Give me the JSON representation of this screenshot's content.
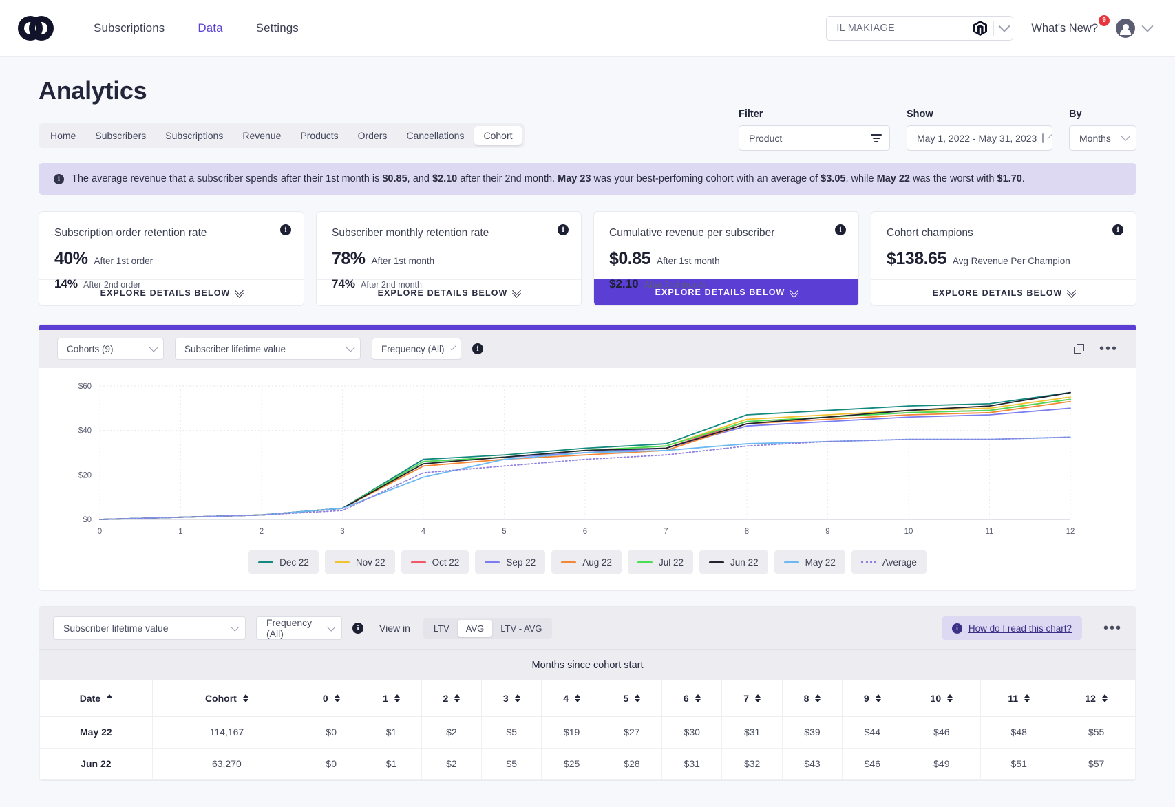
{
  "header": {
    "logo_icon": "loop-logo-icon",
    "nav": [
      {
        "label": "Subscriptions",
        "active": false
      },
      {
        "label": "Data",
        "active": true
      },
      {
        "label": "Settings",
        "active": false
      }
    ],
    "store_selector": {
      "value": "IL MAKIAGE",
      "icon": "magento-icon"
    },
    "whats_new": {
      "label": "What's New?",
      "badge": "9"
    },
    "avatar_icon": "user-avatar-icon"
  },
  "page_title": "Analytics",
  "tabs": [
    {
      "label": "Home",
      "active": false
    },
    {
      "label": "Subscribers",
      "active": false
    },
    {
      "label": "Subscriptions",
      "active": false
    },
    {
      "label": "Revenue",
      "active": false
    },
    {
      "label": "Products",
      "active": false
    },
    {
      "label": "Orders",
      "active": false
    },
    {
      "label": "Cancellations",
      "active": false
    },
    {
      "label": "Cohort",
      "active": true
    }
  ],
  "filters": {
    "filter_label": "Filter",
    "filter_value": "Product",
    "show_label": "Show",
    "show_value": "May 1, 2022  -  May 31, 2023",
    "by_label": "By",
    "by_value": "Months"
  },
  "banner": {
    "part1": "The average revenue that a subscriber spends after their 1st month is ",
    "b1": "$0.85",
    "part2": ", and ",
    "b2": "$2.10",
    "part3": " after their 2nd month. ",
    "b3": "May 23",
    "part4": " was your best-perfoming cohort with an average of ",
    "b4": "$3.05",
    "part5": ", while ",
    "b5": "May 22",
    "part6": " was the worst with ",
    "b6": "$1.70",
    "part7": "."
  },
  "kpis": [
    {
      "title": "Subscription order retention rate",
      "big": "40%",
      "big_sub": "After 1st order",
      "med": "14%",
      "med_sub": "After 2nd order",
      "cta": "EXPLORE DETAILS BELOW",
      "primary": false
    },
    {
      "title": "Subscriber monthly retention rate",
      "big": "78%",
      "big_sub": "After 1st month",
      "med": "74%",
      "med_sub": "After 2nd month",
      "cta": "EXPLORE DETAILS BELOW",
      "primary": false
    },
    {
      "title": "Cumulative revenue per subscriber",
      "big": "$0.85",
      "big_sub": "After 1st month",
      "med": "$2.10",
      "med_sub": "After 2nd month",
      "cta": "EXPLORE DETAILS BELOW",
      "primary": true
    },
    {
      "title": "Cohort champions",
      "big": "$138.65",
      "big_sub": "Avg Revenue Per Champion",
      "med": "",
      "med_sub": "",
      "cta": "EXPLORE DETAILS BELOW",
      "primary": false
    }
  ],
  "chart_controls": {
    "cohorts": "Cohorts (9)",
    "metric": "Subscriber lifetime value",
    "frequency": "Frequency (All)"
  },
  "chart_data": {
    "type": "line",
    "title": "",
    "xlabel": "",
    "ylabel": "",
    "x": [
      0,
      1,
      2,
      3,
      4,
      5,
      6,
      7,
      8,
      9,
      10,
      11,
      12
    ],
    "xticks": [
      "0",
      "1",
      "2",
      "3",
      "4",
      "5",
      "6",
      "7",
      "8",
      "9",
      "10",
      "11",
      "12"
    ],
    "yticks": [
      "$0",
      "$20",
      "$40",
      "$60"
    ],
    "ylim": [
      0,
      60
    ],
    "grid": true,
    "legend_position": "bottom",
    "series": [
      {
        "name": "Dec 22",
        "color": "#14897f",
        "style": "solid",
        "values": [
          0,
          1,
          2,
          5,
          27,
          29,
          32,
          34,
          47,
          49,
          51,
          52,
          57
        ]
      },
      {
        "name": "Nov 22",
        "color": "#f2c230",
        "style": "solid",
        "values": [
          0,
          1,
          2,
          5,
          26,
          28,
          31,
          33,
          45,
          47,
          49,
          50,
          55
        ]
      },
      {
        "name": "Oct 22",
        "color": "#f2566a",
        "style": "solid",
        "values": [
          0,
          1,
          2,
          5,
          26,
          28,
          30,
          32,
          44,
          46,
          48,
          49,
          54
        ]
      },
      {
        "name": "Sep 22",
        "color": "#7b7cf0",
        "style": "solid",
        "values": [
          0,
          1,
          2,
          5,
          26,
          28,
          30,
          32,
          42,
          44,
          46,
          47,
          50
        ]
      },
      {
        "name": "Aug 22",
        "color": "#f58634",
        "style": "solid",
        "values": [
          0,
          1,
          2,
          5,
          24,
          27,
          29,
          31,
          43,
          45,
          47,
          48,
          53
        ]
      },
      {
        "name": "Jul 22",
        "color": "#4ade56",
        "style": "solid",
        "values": [
          0,
          1,
          2,
          5,
          26,
          28,
          31,
          33,
          44,
          46,
          48,
          49,
          54
        ]
      },
      {
        "name": "Jun 22",
        "color": "#22242f",
        "style": "solid",
        "values": [
          0,
          1,
          2,
          5,
          25,
          28,
          31,
          32,
          43,
          46,
          49,
          51,
          57
        ]
      },
      {
        "name": "May 22",
        "color": "#6cb8f2",
        "style": "solid",
        "values": [
          0,
          1,
          2,
          5,
          19,
          27,
          30,
          31,
          34,
          35,
          36,
          36,
          37
        ]
      },
      {
        "name": "Average",
        "color": "#8f7fe0",
        "style": "dotted",
        "values": [
          0,
          1,
          2,
          4,
          21,
          24,
          27,
          29,
          33,
          35,
          36,
          36,
          37
        ]
      }
    ]
  },
  "table_controls": {
    "metric": "Subscriber lifetime value",
    "frequency": "Frequency (All)",
    "view_in_label": "View in",
    "segments": [
      {
        "label": "LTV",
        "active": false
      },
      {
        "label": "AVG",
        "active": true
      },
      {
        "label": "LTV - AVG",
        "active": false
      }
    ],
    "how_to": "How do I read this chart?"
  },
  "table": {
    "span_header": "Months since cohort start",
    "columns": [
      "Date",
      "Cohort",
      "0",
      "1",
      "2",
      "3",
      "4",
      "5",
      "6",
      "7",
      "8",
      "9",
      "10",
      "11",
      "12"
    ],
    "rows": [
      {
        "date": "May 22",
        "cohort": "114,167",
        "values": [
          "$0",
          "$1",
          "$2",
          "$5",
          "$19",
          "$27",
          "$30",
          "$31",
          "$39",
          "$44",
          "$46",
          "$48",
          "$55"
        ]
      },
      {
        "date": "Jun 22",
        "cohort": "63,270",
        "values": [
          "$0",
          "$1",
          "$2",
          "$5",
          "$25",
          "$28",
          "$31",
          "$32",
          "$43",
          "$46",
          "$49",
          "$51",
          "$57"
        ]
      }
    ]
  }
}
